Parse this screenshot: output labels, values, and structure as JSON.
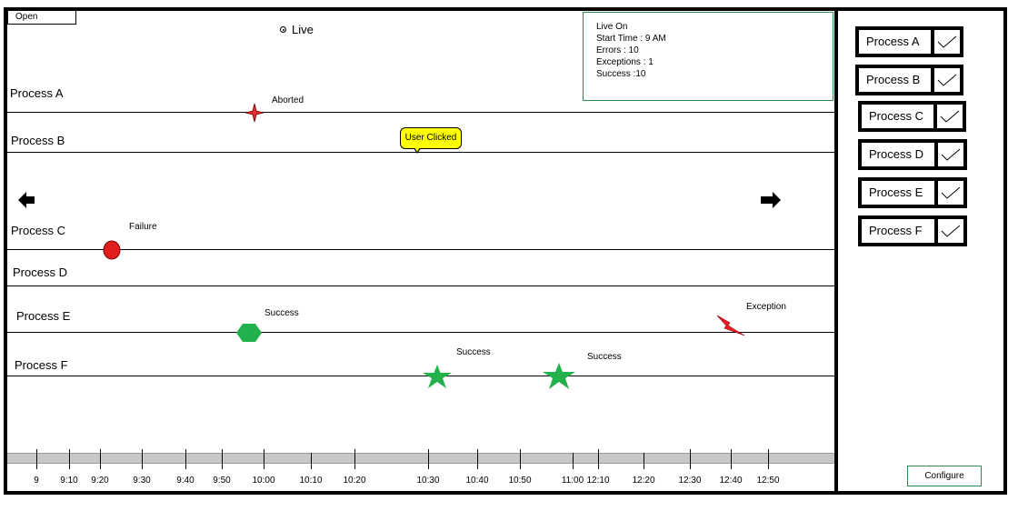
{
  "toolbar": {
    "open_label": "Open"
  },
  "live": {
    "label": "Live"
  },
  "info": {
    "live_on": "Live On",
    "start_time": "Start Time : 9 AM",
    "errors": "Errors : 10",
    "exceptions": "Exceptions : 1",
    "success": "Success :10"
  },
  "lanes": [
    {
      "label": "Process A"
    },
    {
      "label": "Process B"
    },
    {
      "label": "Process C"
    },
    {
      "label": "Process D"
    },
    {
      "label": "Process E"
    },
    {
      "label": "Process F"
    }
  ],
  "events": {
    "aborted": {
      "label": "Aborted",
      "color": "#e03030",
      "icon": "star4-icon"
    },
    "user_clicked": {
      "label": "User Clicked",
      "color": "#ffff00"
    },
    "failure": {
      "label": "Failure",
      "color": "#e01e1e",
      "icon": "circle-icon"
    },
    "success_e": {
      "label": "Success",
      "color": "#22b14c",
      "icon": "hexagon-icon"
    },
    "exception": {
      "label": "Exception",
      "color": "#ed1c24",
      "icon": "lightning-icon"
    },
    "success_f1": {
      "label": "Success",
      "color": "#22b14c",
      "icon": "star-icon"
    },
    "success_f2": {
      "label": "Success",
      "color": "#22b14c",
      "icon": "star-icon"
    }
  },
  "timeline": {
    "labels": [
      "9",
      "9:10",
      "9:20",
      "9:30",
      "9:40",
      "9:50",
      "10:00",
      "10:10",
      "10:20",
      "10:30",
      "10:40",
      "10:50",
      "11:00",
      "12:10",
      "12:20",
      "12:30",
      "12:40",
      "12:50"
    ]
  },
  "sidebar": {
    "items": [
      {
        "label": "Process A",
        "checked": true
      },
      {
        "label": "Process B",
        "checked": true
      },
      {
        "label": "Process C",
        "checked": true
      },
      {
        "label": "Process D",
        "checked": true
      },
      {
        "label": "Process E",
        "checked": true
      },
      {
        "label": "Process F",
        "checked": true
      }
    ],
    "configure_label": "Configure"
  },
  "colors": {
    "frame": "#000000",
    "accent_border": "#2e8b57",
    "timeline_bar": "#c8c8c8"
  }
}
